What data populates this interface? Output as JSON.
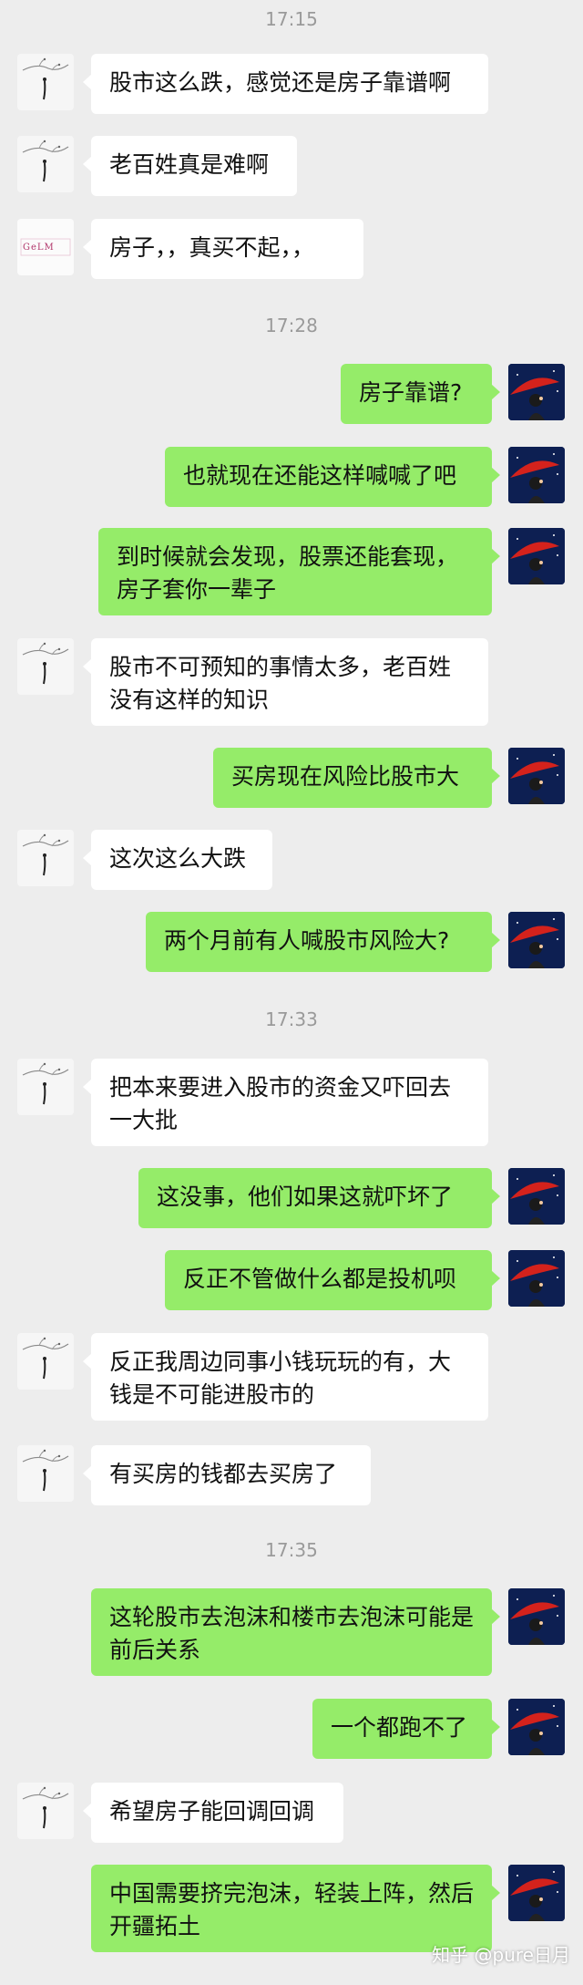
{
  "timestamps": [
    "17:15",
    "17:28",
    "17:33",
    "17:35"
  ],
  "messages": [
    {
      "side": "left",
      "text": "股市这么跌，感觉还是房子靠谱啊"
    },
    {
      "side": "left",
      "text": "老百姓真是难啊"
    },
    {
      "side": "left",
      "text": "房子，，真买不起，，"
    },
    {
      "side": "right",
      "text": "房子靠谱?"
    },
    {
      "side": "right",
      "text": "也就现在还能这样喊喊了吧"
    },
    {
      "side": "right",
      "text": "到时候就会发现，股票还能套现，房子套你一辈子"
    },
    {
      "side": "left",
      "text": "股市不可预知的事情太多，老百姓没有这样的知识"
    },
    {
      "side": "right",
      "text": "买房现在风险比股市大"
    },
    {
      "side": "left",
      "text": "这次这么大跌"
    },
    {
      "side": "right",
      "text": "两个月前有人喊股市风险大?"
    },
    {
      "side": "left",
      "text": "把本来要进入股市的资金又吓回去一大批"
    },
    {
      "side": "right",
      "text": "这没事，他们如果这就吓坏了"
    },
    {
      "side": "right",
      "text": "反正不管做什么都是投机呗"
    },
    {
      "side": "left",
      "text": "反正我周边同事小钱玩玩的有，大钱是不可能进股市的"
    },
    {
      "side": "left",
      "text": "有买房的钱都去买房了"
    },
    {
      "side": "right",
      "text": "这轮股市去泡沫和楼市去泡沫可能是前后关系"
    },
    {
      "side": "right",
      "text": "一个都跑不了"
    },
    {
      "side": "left",
      "text": "希望房子能回调回调"
    },
    {
      "side": "right",
      "text": "中国需要挤完泡沫，轻装上阵，然后开疆拓土"
    }
  ],
  "avatars": {
    "logo_text": "GeLM"
  },
  "watermark": "知乎 @pure日月",
  "colors": {
    "background": "#ededed",
    "bubble_left": "#ffffff",
    "bubble_right": "#95ec69",
    "timestamp": "#9a9a9a"
  },
  "icons": {
    "left_avatar": "ink-branch-illustration-icon",
    "logo_avatar": "brand-logo-icon",
    "right_avatar": "night-sky-red-umbrella-icon"
  }
}
